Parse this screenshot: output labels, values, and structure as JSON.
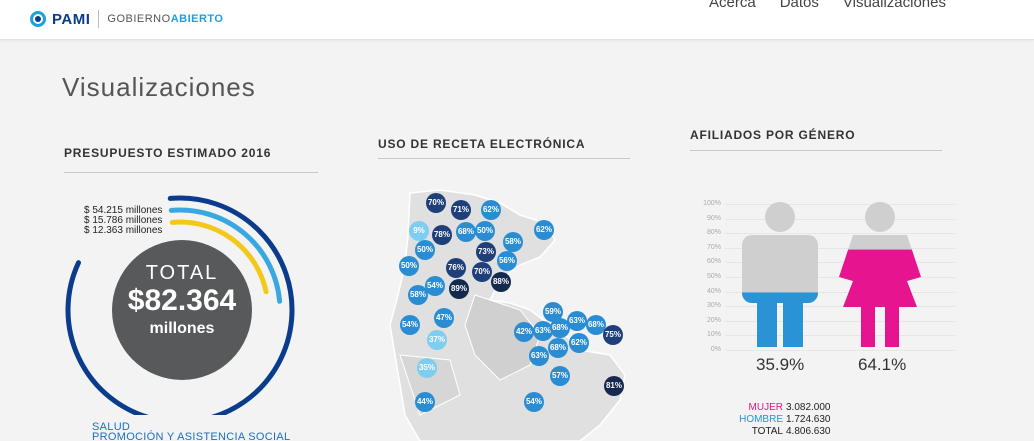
{
  "header": {
    "brand": "PAMI",
    "sub_a": "GOBIERNO",
    "sub_b": "ABIERTO",
    "nav": [
      "Acerca",
      "Datos",
      "Visualizaciones"
    ]
  },
  "page_title": "Visualizaciones",
  "budget": {
    "title": "PRESUPUESTO ESTIMADO 2016",
    "lines": [
      "$ 54.215 millones",
      "$ 15.786 millones",
      "$ 12.363 millones"
    ],
    "total_label": "TOTAL",
    "total_amount": "$82.364",
    "total_unit": "millones",
    "categories": [
      "SALUD",
      "PROMOCIÓN Y ASISTENCIA SOCIAL"
    ],
    "ring_colors": [
      "#0a3b8c",
      "#3aa8e0",
      "#f2c81a"
    ]
  },
  "prescription": {
    "title": "USO DE RECETA ELECTRÓNICA",
    "pins": [
      {
        "value": "70%",
        "tone": "dark"
      },
      {
        "value": "71%",
        "tone": "dark"
      },
      {
        "value": "62%",
        "tone": "mid"
      },
      {
        "value": "62%",
        "tone": "mid"
      },
      {
        "value": "9%",
        "tone": "light"
      },
      {
        "value": "78%",
        "tone": "dark"
      },
      {
        "value": "68%",
        "tone": "mid"
      },
      {
        "value": "50%",
        "tone": "mid"
      },
      {
        "value": "58%",
        "tone": "mid"
      },
      {
        "value": "50%",
        "tone": "mid"
      },
      {
        "value": "73%",
        "tone": "dark"
      },
      {
        "value": "50%",
        "tone": "mid"
      },
      {
        "value": "76%",
        "tone": "dark"
      },
      {
        "value": "70%",
        "tone": "dark"
      },
      {
        "value": "56%",
        "tone": "mid"
      },
      {
        "value": "54%",
        "tone": "mid"
      },
      {
        "value": "89%",
        "tone": "navy"
      },
      {
        "value": "88%",
        "tone": "navy"
      },
      {
        "value": "58%",
        "tone": "mid"
      },
      {
        "value": "59%",
        "tone": "mid"
      },
      {
        "value": "47%",
        "tone": "mid"
      },
      {
        "value": "54%",
        "tone": "mid"
      },
      {
        "value": "42%",
        "tone": "mid"
      },
      {
        "value": "63%",
        "tone": "mid"
      },
      {
        "value": "68%",
        "tone": "mid"
      },
      {
        "value": "63%",
        "tone": "mid"
      },
      {
        "value": "68%",
        "tone": "mid"
      },
      {
        "value": "75%",
        "tone": "dark"
      },
      {
        "value": "37%",
        "tone": "light"
      },
      {
        "value": "63%",
        "tone": "mid"
      },
      {
        "value": "68%",
        "tone": "mid"
      },
      {
        "value": "62%",
        "tone": "mid"
      },
      {
        "value": "35%",
        "tone": "light"
      },
      {
        "value": "57%",
        "tone": "mid"
      },
      {
        "value": "81%",
        "tone": "navy"
      },
      {
        "value": "44%",
        "tone": "mid"
      },
      {
        "value": "54%",
        "tone": "mid"
      }
    ]
  },
  "gender": {
    "title": "AFILIADOS POR GÉNERO",
    "axis": [
      "100%",
      "90%",
      "80%",
      "70%",
      "60%",
      "50%",
      "40%",
      "30%",
      "20%",
      "10%",
      "0%"
    ],
    "male_pct_label": "35.9%",
    "female_pct_label": "64.1%",
    "male_fraction": 0.359,
    "female_fraction": 0.641,
    "male_color": "#2a93d6",
    "female_color": "#e6158f",
    "figure_color": "#cfcfcf",
    "stats": [
      {
        "label": "MUJER",
        "value": "3.082.000",
        "color": "#e6158f"
      },
      {
        "label": "HOMBRE",
        "value": "1.724.630",
        "color": "#2a93d6"
      },
      {
        "label": "TOTAL",
        "value": "4.806.630",
        "color": "#222222"
      }
    ]
  }
}
